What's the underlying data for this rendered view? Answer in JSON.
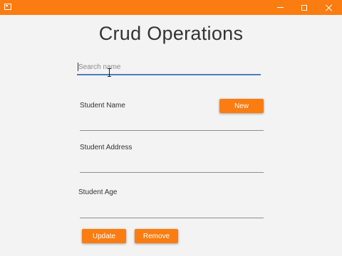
{
  "colors": {
    "accent": "#fb7c10",
    "window_bg": "#f3f3f3",
    "focus_underline": "#4f7cb8"
  },
  "titlebar": {
    "icons": [
      "app-icon",
      "minimize-icon",
      "maximize-icon",
      "close-icon"
    ]
  },
  "main": {
    "title": "Crud Operations",
    "search": {
      "placeholder": "Search name",
      "value": ""
    },
    "student_name": {
      "label": "Student Name",
      "value": ""
    },
    "new_button": "New",
    "student_address": {
      "label": "Student Address",
      "value": ""
    },
    "student_age": {
      "label": "Student Age",
      "value": ""
    },
    "update_button": "Update",
    "remove_button": "Remove"
  }
}
